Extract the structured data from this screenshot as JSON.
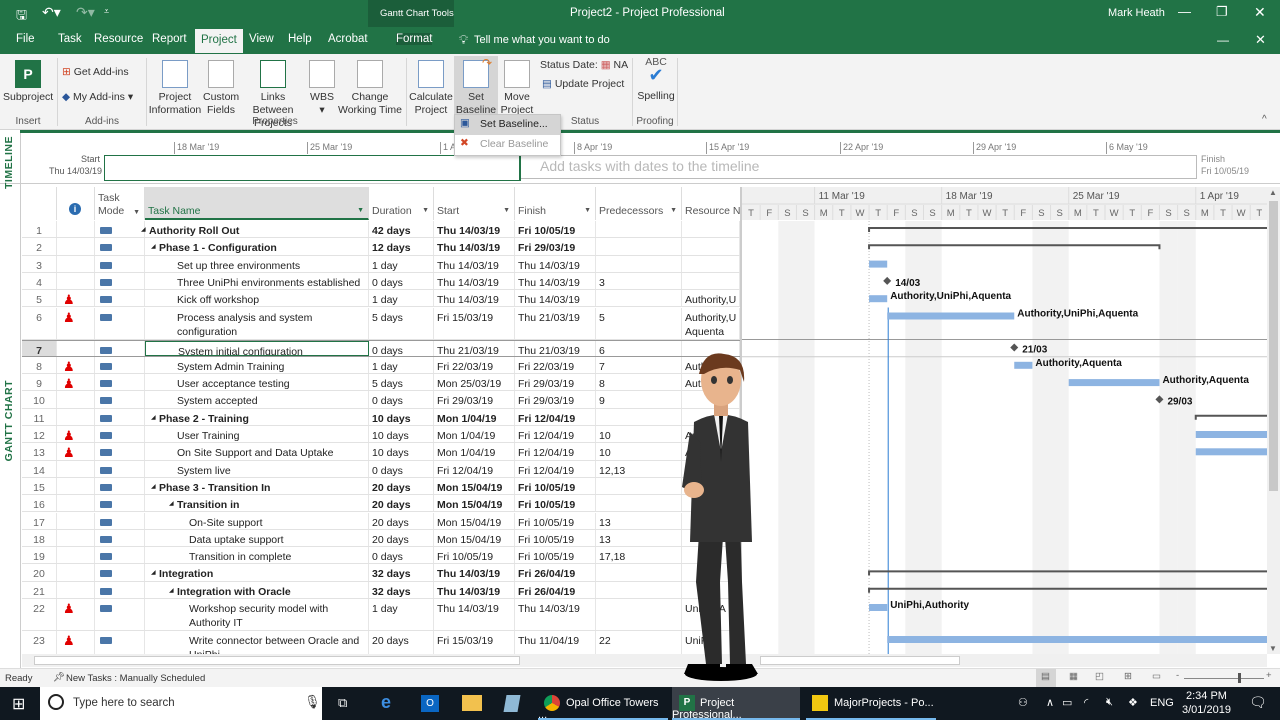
{
  "titlebar": {
    "tools_group": "Gantt Chart Tools",
    "title": "Project2  -  Project Professional",
    "user": "Mark Heath"
  },
  "tabs": [
    "File",
    "Task",
    "Resource",
    "Report",
    "Project",
    "View",
    "Help",
    "Acrobat",
    "Format"
  ],
  "active_tab": "Project",
  "tell_me": "Tell me what you want to do",
  "ribbon": {
    "subproject": "Subproject",
    "get_addins": "Get Add-ins",
    "my_addins": "My Add-ins",
    "project_information": "Project Information",
    "custom_fields": "Custom Fields",
    "links_between_projects": "Links Between Projects",
    "wbs": "WBS",
    "change_working_time": "Change Working Time",
    "calculate_project": "Calculate Project",
    "set_baseline": "Set Baseline",
    "move_project": "Move Project",
    "status_date_label": "Status Date:",
    "status_date_value": "NA",
    "update_project": "Update Project",
    "spelling": "Spelling",
    "abc": "ABC",
    "groups": {
      "insert": "Insert",
      "addins": "Add-ins",
      "properties": "Properties",
      "status": "Status",
      "proofing": "Proofing"
    }
  },
  "baseline_menu": {
    "set": "Set Baseline...",
    "clear": "Clear Baseline"
  },
  "timeline": {
    "label": "TIMELINE",
    "start_label": "Start",
    "start_date": "Thu 14/03/19",
    "finish_label": "Finish",
    "finish_date": "Fri 10/05/19",
    "placeholder": "Add tasks with dates to the timeline",
    "ticks": [
      "18 Mar '19",
      "25 Mar '19",
      "1 A",
      "8 Apr '19",
      "15 Apr '19",
      "22 Apr '19",
      "29 Apr '19",
      "6 May '19"
    ]
  },
  "view_label": "GANTT CHART",
  "columns": {
    "mode": "Task Mode",
    "name": "Task Name",
    "duration": "Duration",
    "start": "Start",
    "finish": "Finish",
    "predecessors": "Predecessors",
    "resource": "Resource N"
  },
  "tasks": [
    {
      "id": "1",
      "name": "Authority Roll Out",
      "level": 0,
      "summary": true,
      "duration": "42 days",
      "start": "Thu 14/03/19",
      "finish": "Fri 10/05/19",
      "pred": "",
      "res": "",
      "person": false
    },
    {
      "id": "2",
      "name": "Phase 1 - Configuration",
      "level": 1,
      "summary": true,
      "duration": "12 days",
      "start": "Thu 14/03/19",
      "finish": "Fri 29/03/19",
      "pred": "",
      "res": "",
      "person": false
    },
    {
      "id": "3",
      "name": "Set up three environments",
      "level": 2,
      "duration": "1 day",
      "start": "Thu 14/03/19",
      "finish": "Thu 14/03/19",
      "pred": "",
      "res": "",
      "person": false
    },
    {
      "id": "4",
      "name": "Three UniPhi environments established",
      "level": 2,
      "duration": "0 days",
      "start": "Thu 14/03/19",
      "finish": "Thu 14/03/19",
      "pred": "3",
      "res": "",
      "person": false
    },
    {
      "id": "5",
      "name": "Kick off workshop",
      "level": 2,
      "duration": "1 day",
      "start": "Thu 14/03/19",
      "finish": "Thu 14/03/19",
      "pred": "",
      "res": "Authority,U",
      "person": true
    },
    {
      "id": "6",
      "name": "Process analysis and system configuration",
      "level": 2,
      "tall": true,
      "duration": "5 days",
      "start": "Fri 15/03/19",
      "finish": "Thu 21/03/19",
      "pred": "5",
      "res": "Authority,U Aquenta",
      "person": true
    },
    {
      "id": "7",
      "name": "System initial configuration",
      "level": 2,
      "selected": true,
      "duration": "0 days",
      "start": "Thu 21/03/19",
      "finish": "Thu 21/03/19",
      "pred": "6",
      "res": "",
      "person": false
    },
    {
      "id": "8",
      "name": "System Admin Training",
      "level": 2,
      "duration": "1 day",
      "start": "Fri 22/03/19",
      "finish": "Fri 22/03/19",
      "pred": "7",
      "res": "Authority,A",
      "person": true
    },
    {
      "id": "9",
      "name": "User acceptance testing",
      "level": 2,
      "duration": "5 days",
      "start": "Mon 25/03/19",
      "finish": "Fri 29/03/19",
      "pred": "8",
      "res": "Authority,A",
      "person": true
    },
    {
      "id": "10",
      "name": "System accepted",
      "level": 2,
      "duration": "0 days",
      "start": "Fri 29/03/19",
      "finish": "Fri 29/03/19",
      "pred": "9",
      "res": "",
      "person": false
    },
    {
      "id": "11",
      "name": "Phase 2 - Training",
      "level": 1,
      "summary": true,
      "duration": "10 days",
      "start": "Mon 1/04/19",
      "finish": "Fri 12/04/19",
      "pred": "",
      "res": "",
      "person": false
    },
    {
      "id": "12",
      "name": "User Training",
      "level": 2,
      "duration": "10 days",
      "start": "Mon 1/04/19",
      "finish": "Fri 12/04/19",
      "pred": "10",
      "res": "Authority",
      "person": true
    },
    {
      "id": "13",
      "name": "On Site Support and Data Uptake",
      "level": 2,
      "duration": "10 days",
      "start": "Mon 1/04/19",
      "finish": "Fri 12/04/19",
      "pred": "10",
      "res": "Authority",
      "person": true
    },
    {
      "id": "14",
      "name": "System live",
      "level": 2,
      "duration": "0 days",
      "start": "Fri 12/04/19",
      "finish": "Fri 12/04/19",
      "pred": "12,13",
      "res": "",
      "person": false
    },
    {
      "id": "15",
      "name": "Phase 3 - Transition In",
      "level": 1,
      "summary": true,
      "duration": "20 days",
      "start": "Mon 15/04/19",
      "finish": "Fri 10/05/19",
      "pred": "",
      "res": "",
      "person": false
    },
    {
      "id": "16",
      "name": "Transition in",
      "level": 2,
      "summary": true,
      "duration": "20 days",
      "start": "Mon 15/04/19",
      "finish": "Fri 10/05/19",
      "pred": "",
      "res": "",
      "person": false
    },
    {
      "id": "17",
      "name": "On-Site support",
      "level": 3,
      "duration": "20 days",
      "start": "Mon 15/04/19",
      "finish": "Fri 10/05/19",
      "pred": "13",
      "res": "",
      "person": false
    },
    {
      "id": "18",
      "name": "Data uptake support",
      "level": 3,
      "duration": "20 days",
      "start": "Mon 15/04/19",
      "finish": "Fri 10/05/19",
      "pred": "13",
      "res": "",
      "person": false
    },
    {
      "id": "19",
      "name": "Transition in complete",
      "level": 3,
      "duration": "0 days",
      "start": "Fri 10/05/19",
      "finish": "Fri 10/05/19",
      "pred": "17,18",
      "res": "",
      "person": false
    },
    {
      "id": "20",
      "name": "Integration",
      "level": 1,
      "summary": true,
      "duration": "32 days",
      "start": "Thu 14/03/19",
      "finish": "Fri 26/04/19",
      "pred": "",
      "res": "",
      "person": false
    },
    {
      "id": "21",
      "name": "Integration with Oracle",
      "level": 2,
      "summary": true,
      "duration": "32 days",
      "start": "Thu 14/03/19",
      "finish": "Fri 26/04/19",
      "pred": "",
      "res": "",
      "person": false
    },
    {
      "id": "22",
      "name": "Workshop security model with Authority IT",
      "level": 3,
      "tall": true,
      "duration": "1 day",
      "start": "Thu 14/03/19",
      "finish": "Thu 14/03/19",
      "pred": "",
      "res": "UniPhi,A",
      "person": true
    },
    {
      "id": "23",
      "name": "Write connector between Oracle and UniPhi",
      "level": 3,
      "tall": true,
      "duration": "20 days",
      "start": "Fri 15/03/19",
      "finish": "Thu 11/04/19",
      "pred": "22",
      "res": "UniPhi",
      "person": true
    }
  ],
  "gantt": {
    "weeks": [
      "11 Mar '19",
      "18 Mar '19",
      "25 Mar '19",
      "1 Apr '19"
    ],
    "days": [
      "T",
      "F",
      "S",
      "S",
      "M",
      "T",
      "W",
      "T",
      "F",
      "S",
      "S",
      "M",
      "T",
      "W",
      "T",
      "F",
      "S",
      "S",
      "M",
      "T",
      "W",
      "T",
      "F",
      "S",
      "S",
      "M",
      "T",
      "W",
      "T"
    ],
    "first_day": "Thu 7 Mar '19",
    "bars": [
      {
        "row": 0,
        "type": "summary",
        "start": 7,
        "end": 30
      },
      {
        "row": 1,
        "type": "summary",
        "start": 7,
        "end": 23
      },
      {
        "row": 2,
        "type": "task",
        "start": 7,
        "end": 8
      },
      {
        "row": 3,
        "type": "milestone",
        "start": 8,
        "label": "14/03"
      },
      {
        "row": 4,
        "type": "task",
        "start": 7,
        "end": 8,
        "label": "Authority,UniPhi,Aquenta"
      },
      {
        "row": 5,
        "type": "task",
        "start": 8,
        "end": 15,
        "label": "Authority,UniPhi,Aquenta"
      },
      {
        "row": 6,
        "type": "milestone",
        "start": 15,
        "label": "21/03"
      },
      {
        "row": 7,
        "type": "task",
        "start": 15,
        "end": 16,
        "label": "Authority,Aquenta"
      },
      {
        "row": 8,
        "type": "task",
        "start": 18,
        "end": 23,
        "label": "Authority,Aquenta"
      },
      {
        "row": 9,
        "type": "milestone",
        "start": 23,
        "label": "29/03"
      },
      {
        "row": 10,
        "type": "summary",
        "start": 25,
        "end": 30
      },
      {
        "row": 11,
        "type": "task",
        "start": 25,
        "end": 30
      },
      {
        "row": 12,
        "type": "task",
        "start": 25,
        "end": 30
      },
      {
        "row": 19,
        "type": "summary",
        "start": 7,
        "end": 30
      },
      {
        "row": 20,
        "type": "summary",
        "start": 7,
        "end": 30
      },
      {
        "row": 21,
        "type": "task",
        "start": 7,
        "end": 8,
        "label": "UniPhi,Authority"
      },
      {
        "row": 22,
        "type": "task",
        "start": 8,
        "end": 30
      }
    ]
  },
  "status": {
    "ready": "Ready",
    "new_tasks": "New Tasks : Manually Scheduled"
  },
  "taskbar": {
    "search": "Type here to search",
    "apps": [
      "Opal Office Towers ...",
      "Project Professional...",
      "MajorProjects - Po..."
    ],
    "lang": "ENG",
    "time": "2:34 PM",
    "date": "3/01/2019"
  },
  "colors": {
    "brand": "#217346",
    "bar": "#8db4e2"
  }
}
